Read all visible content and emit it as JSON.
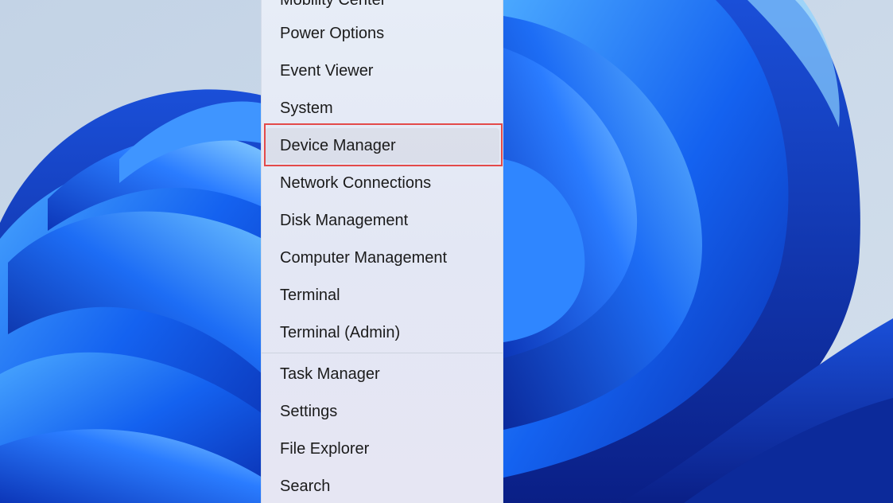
{
  "accent_colors": {
    "highlight_border": "#e34a4a",
    "menu_background": "#e5eaf5",
    "wallpaper_blue": "#1a5df0"
  },
  "context_menu": {
    "partially_visible_item": "Mobility Center",
    "items": [
      {
        "id": "power-options",
        "label": "Power Options"
      },
      {
        "id": "event-viewer",
        "label": "Event Viewer"
      },
      {
        "id": "system",
        "label": "System"
      },
      {
        "id": "device-manager",
        "label": "Device Manager",
        "highlighted": true
      },
      {
        "id": "network-connections",
        "label": "Network Connections"
      },
      {
        "id": "disk-management",
        "label": "Disk Management"
      },
      {
        "id": "computer-management",
        "label": "Computer Management"
      },
      {
        "id": "terminal",
        "label": "Terminal"
      },
      {
        "id": "terminal-admin",
        "label": "Terminal (Admin)"
      },
      {
        "id": "task-manager",
        "label": "Task Manager"
      },
      {
        "id": "settings",
        "label": "Settings"
      },
      {
        "id": "file-explorer",
        "label": "File Explorer"
      },
      {
        "id": "search",
        "label": "Search"
      }
    ]
  }
}
